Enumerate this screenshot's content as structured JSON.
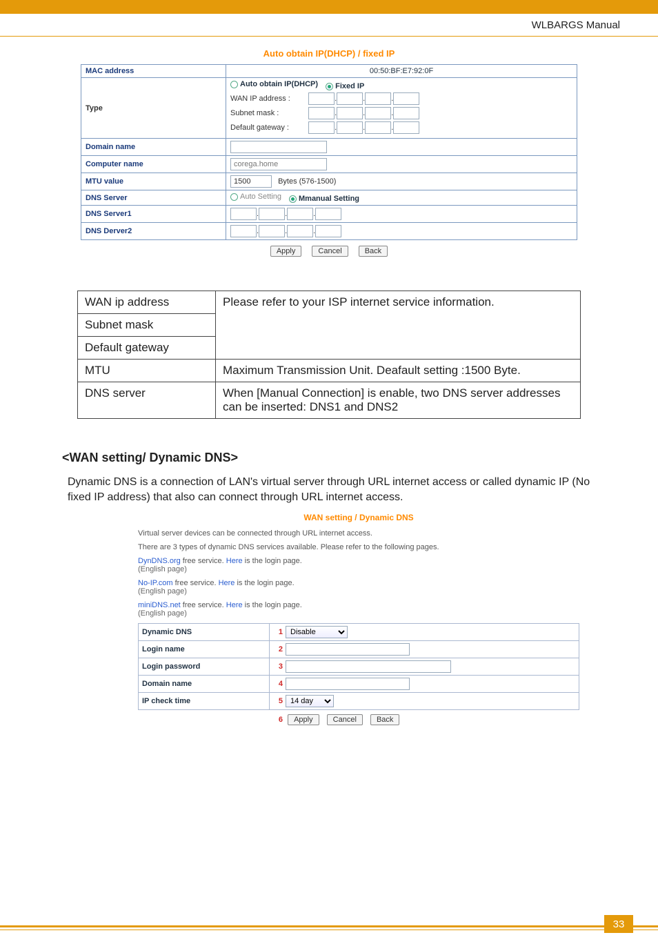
{
  "header": {
    "title": "WLBARGS Manual"
  },
  "shot1": {
    "title": "Auto obtain IP(DHCP) / fixed IP",
    "rows": {
      "mac_label": "MAC address",
      "mac_value": "00:50:BF:E7:92:0F",
      "type_label": "Type",
      "radio_auto": "Auto obtain IP(DHCP)",
      "radio_fixed": "Fixed IP",
      "wan_ip_label": "WAN IP address :",
      "subnet_label": "Subnet mask :",
      "gateway_label": "Default gateway :",
      "domain_label": "Domain name",
      "computer_label": "Computer name",
      "computer_value": "corega.home",
      "mtu_label": "MTU value",
      "mtu_value": "1500",
      "mtu_hint": "Bytes (576-1500)",
      "dns_label": "DNS Server",
      "dns_auto": "Auto Setting",
      "dns_manual": "Mmanual Setting",
      "dns1_label": "DNS Server1",
      "dns2_label": "DNS Derver2"
    },
    "buttons": {
      "apply": "Apply",
      "cancel": "Cancel",
      "back": "Back"
    }
  },
  "desc": {
    "r1k": "WAN ip address",
    "r2k": "Subnet mask",
    "r3k": "Default gateway",
    "r123v": "Please refer to your ISP internet service information.",
    "r4k": "MTU",
    "r4v": "Maximum Transmission Unit. Deafault setting :1500 Byte.",
    "r5k": "DNS server",
    "r5v": "When [Manual Connection] is enable, two DNS server addresses can be inserted: DNS1 and DNS2"
  },
  "section": {
    "heading": "<WAN setting/ Dynamic DNS>",
    "para": "Dynamic DNS is a connection of LAN's virtual server through URL internet access or called dynamic IP (No fixed IP address) that also can connect through URL internet access."
  },
  "shot2": {
    "title": "WAN setting / Dynamic DNS",
    "line1": "Virtual server devices can be connected through URL internet access.",
    "line2": "There are 3 types of dynamic DNS services available. Please refer to the following pages.",
    "svc1_link": "DynDNS.org",
    "svc1_rest": "  free service. ",
    "svc1_here": "Here",
    "svc1_tail": " is the login page.",
    "svc1_sub": "(English page)",
    "svc2_link": "No-IP.com",
    "svc2_rest": "  free service. ",
    "svc2_here": "Here",
    "svc2_tail": " is the login page.",
    "svc2_sub": "(English page)",
    "svc3_link": "miniDNS.net",
    "svc3_rest": "  free service. ",
    "svc3_here": "Here",
    "svc3_tail": " is the login page.",
    "svc3_sub": "(English page)",
    "rows": {
      "ddns": "Dynamic DNS",
      "ddns_sel": "Disable",
      "login": "Login name",
      "pass": "Login password",
      "domain": "Domain name",
      "ipcheck": "IP check time",
      "ipcheck_sel": "14 day"
    },
    "nums": {
      "n1": "1",
      "n2": "2",
      "n3": "3",
      "n4": "4",
      "n5": "5",
      "n6": "6"
    },
    "buttons": {
      "apply": "Apply",
      "cancel": "Cancel",
      "back": "Back"
    }
  },
  "footer": {
    "page": "33"
  }
}
